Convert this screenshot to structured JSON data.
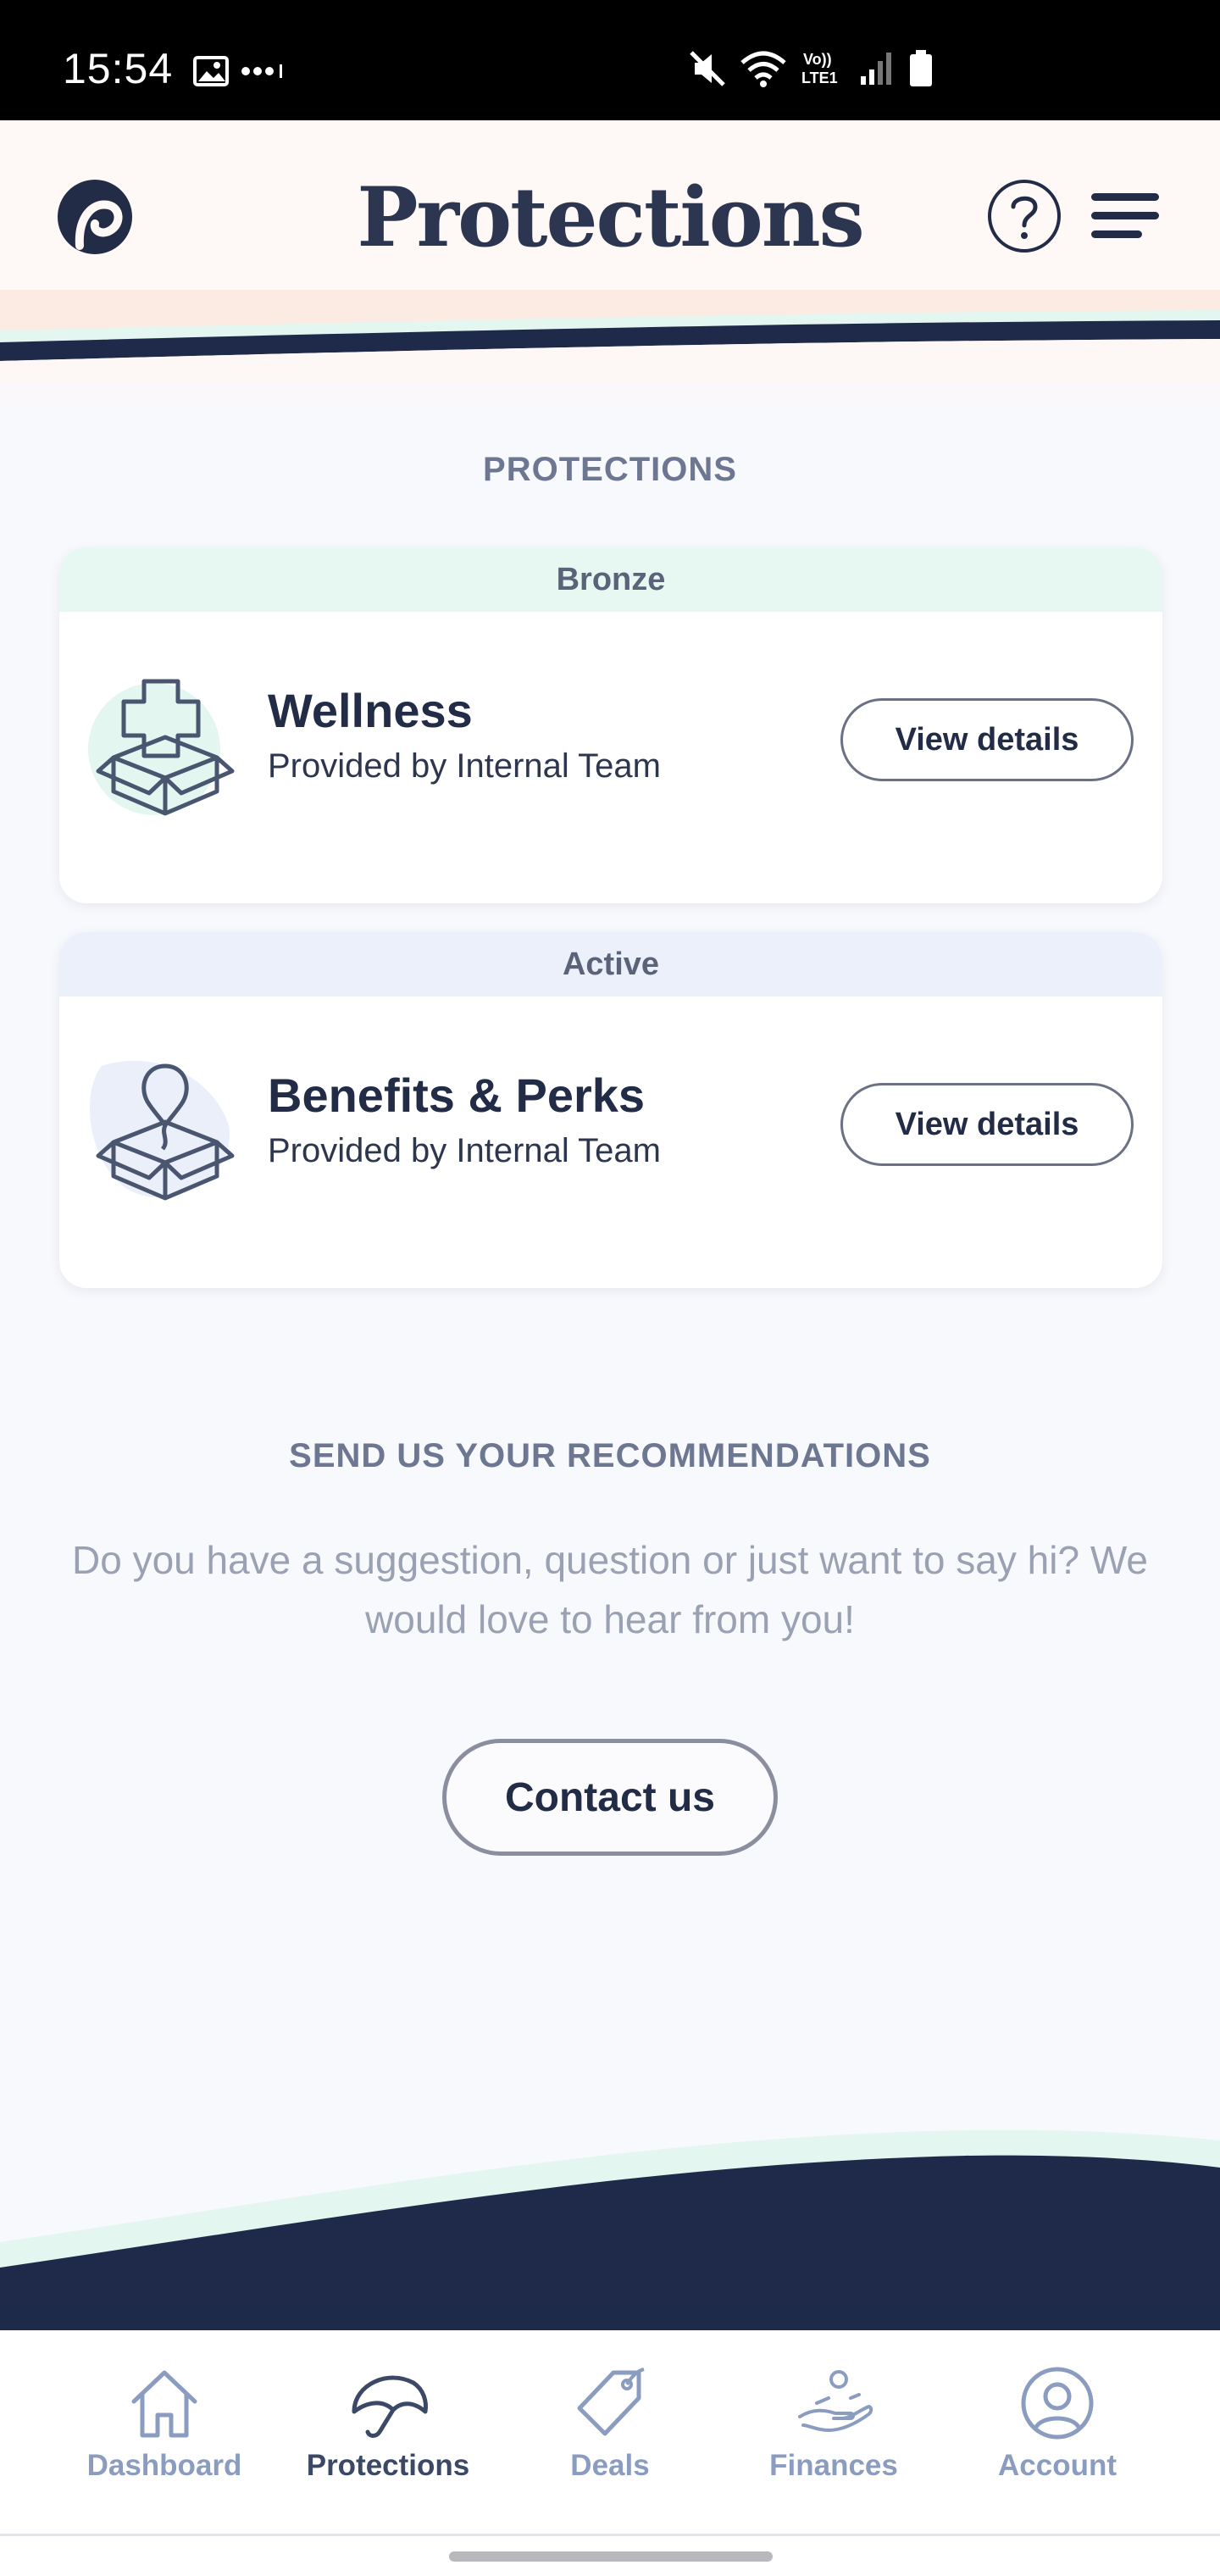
{
  "status_bar": {
    "time": "15:54",
    "left_icons": [
      "gallery-icon",
      "more-dots-icon"
    ],
    "right_icons": [
      "mute-icon",
      "wifi-icon",
      "volte-icon",
      "signal-icon",
      "battery-icon"
    ],
    "volte_label": "Vo))\nLTE1"
  },
  "header": {
    "title": "Protections",
    "logo_icon": "brand-logo-icon",
    "help_icon": "help-icon",
    "menu_icon": "hamburger-menu-icon"
  },
  "main": {
    "section_title": "PROTECTIONS",
    "cards": [
      {
        "tier": "Bronze",
        "title": "Wellness",
        "provider": "Provided by Internal Team",
        "icon": "medical-box-icon",
        "button_label": "View details"
      },
      {
        "tier": "Active",
        "title": "Benefits & Perks",
        "provider": "Provided by Internal Team",
        "icon": "balloon-box-icon",
        "button_label": "View details"
      }
    ],
    "recommend_title": "SEND US YOUR RECOMMENDATIONS",
    "recommend_text": "Do you have a suggestion, question or just want to say hi? We would love to hear from you!",
    "contact_label": "Contact us"
  },
  "bottom_nav": {
    "items": [
      {
        "label": "Dashboard",
        "icon": "home-icon",
        "selected": false
      },
      {
        "label": "Protections",
        "icon": "umbrella-icon",
        "selected": true
      },
      {
        "label": "Deals",
        "icon": "tag-icon",
        "selected": false
      },
      {
        "label": "Finances",
        "icon": "hand-coin-icon",
        "selected": false
      },
      {
        "label": "Account",
        "icon": "user-circle-icon",
        "selected": false
      }
    ]
  },
  "colors": {
    "navy": "#1f2a4a",
    "mint": "#e3f6ef",
    "peach": "#fce9e2",
    "nav_inactive": "#8a9cc0"
  }
}
